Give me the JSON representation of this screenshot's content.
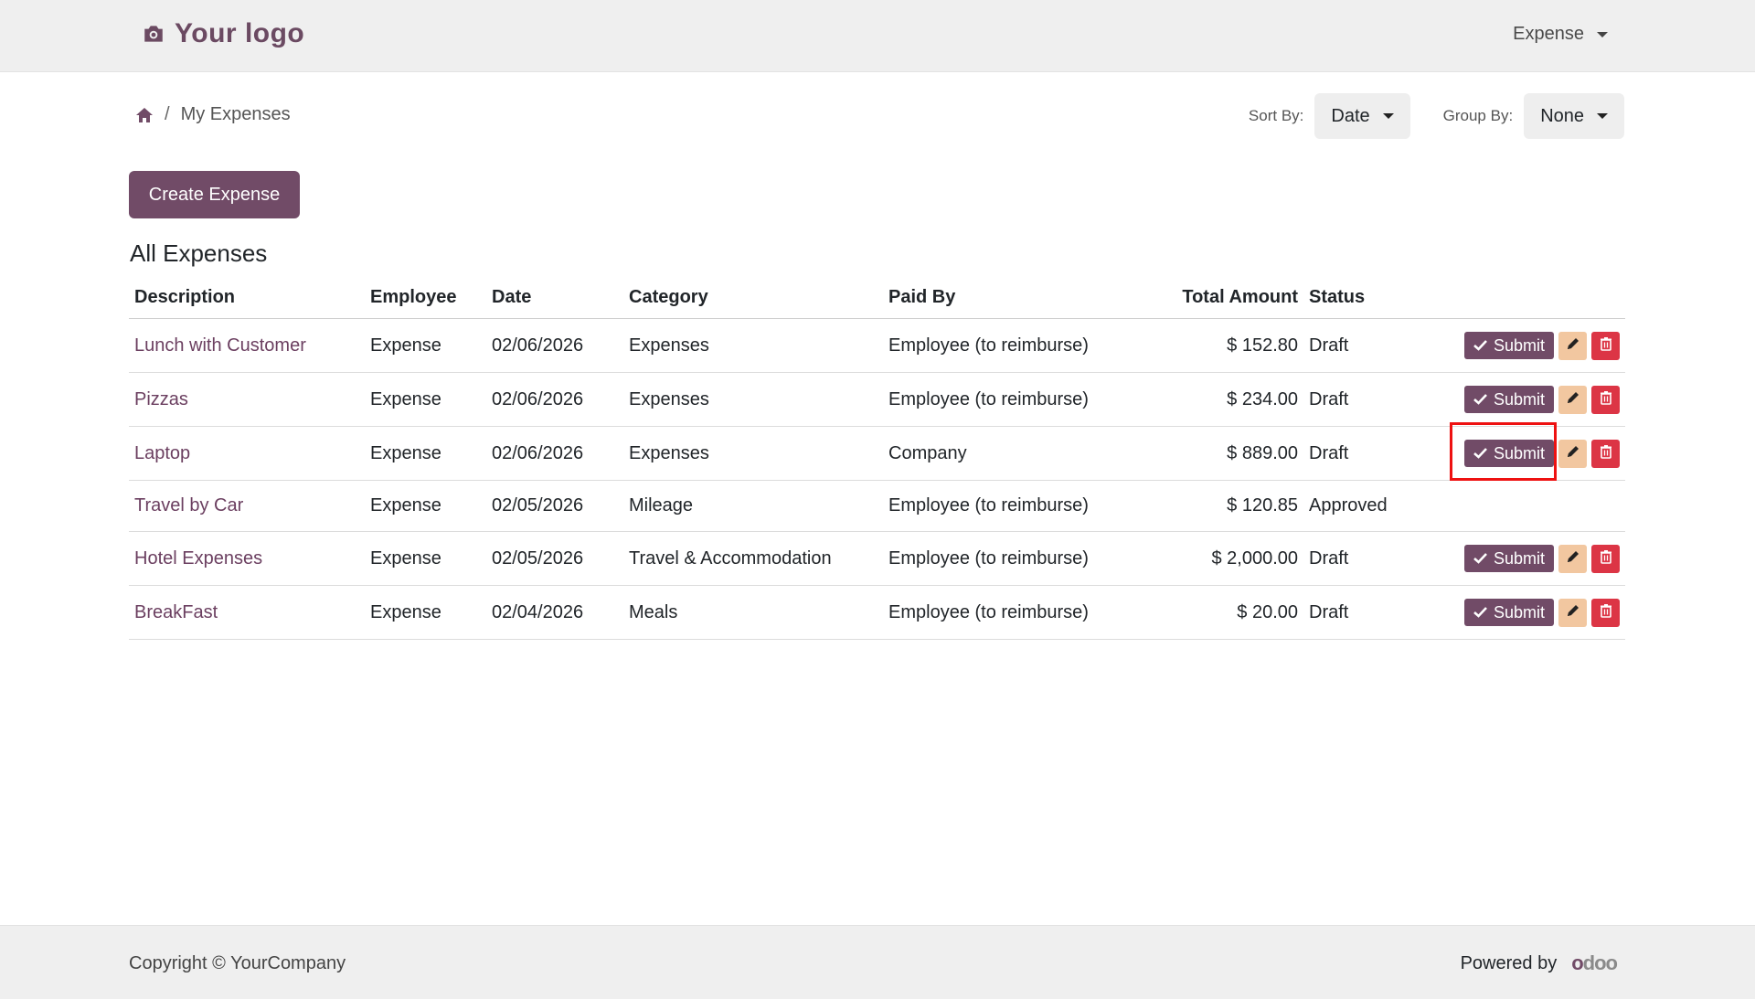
{
  "header": {
    "logo_text": "Your logo",
    "menu_label": "Expense"
  },
  "breadcrumb": {
    "current": "My Expenses",
    "separator": "/"
  },
  "sort": {
    "label": "Sort By:",
    "value": "Date"
  },
  "group": {
    "label": "Group By:",
    "value": "None"
  },
  "create_button": "Create Expense",
  "section_title": "All Expenses",
  "table": {
    "columns": [
      "Description",
      "Employee",
      "Date",
      "Category",
      "Paid By",
      "Total Amount",
      "Status"
    ],
    "rows": [
      {
        "description": "Lunch with Customer",
        "employee": "Expense",
        "date": "02/06/2026",
        "category": "Expenses",
        "paid_by": "Employee (to reimburse)",
        "amount": "$ 152.80",
        "status": "Draft",
        "actions": true
      },
      {
        "description": "Pizzas",
        "employee": "Expense",
        "date": "02/06/2026",
        "category": "Expenses",
        "paid_by": "Employee (to reimburse)",
        "amount": "$ 234.00",
        "status": "Draft",
        "actions": true
      },
      {
        "description": "Laptop",
        "employee": "Expense",
        "date": "02/06/2026",
        "category": "Expenses",
        "paid_by": "Company",
        "amount": "$ 889.00",
        "status": "Draft",
        "actions": true
      },
      {
        "description": "Travel by Car",
        "employee": "Expense",
        "date": "02/05/2026",
        "category": "Mileage",
        "paid_by": "Employee (to reimburse)",
        "amount": "$ 120.85",
        "status": "Approved",
        "actions": false
      },
      {
        "description": "Hotel Expenses",
        "employee": "Expense",
        "date": "02/05/2026",
        "category": "Travel & Accommodation",
        "paid_by": "Employee (to reimburse)",
        "amount": "$ 2,000.00",
        "status": "Draft",
        "actions": true
      },
      {
        "description": "BreakFast",
        "employee": "Expense",
        "date": "02/04/2026",
        "category": "Meals",
        "paid_by": "Employee (to reimburse)",
        "amount": "$ 20.00",
        "status": "Draft",
        "actions": true
      }
    ],
    "submit_label": "Submit"
  },
  "footer": {
    "copyright": "Copyright © YourCompany",
    "powered_by": "Powered by",
    "brand": "odoo"
  },
  "colors": {
    "primary": "#714b67",
    "edit": "#f2c7a0",
    "delete": "#dc3545",
    "highlight": "#ee1111"
  }
}
